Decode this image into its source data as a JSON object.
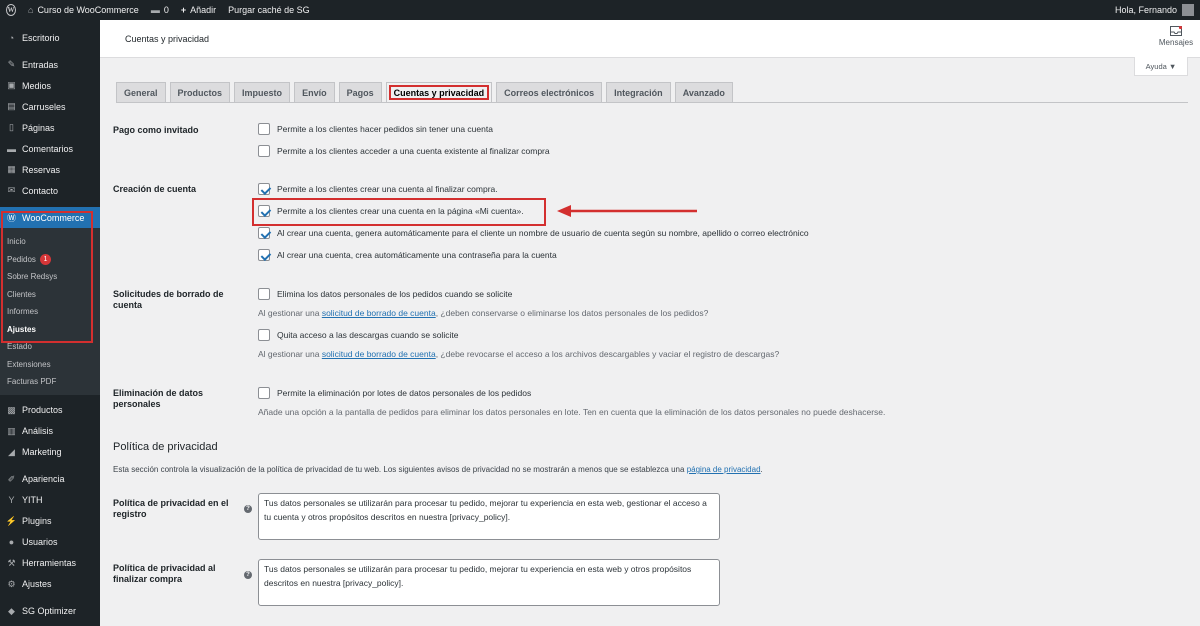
{
  "adminbar": {
    "site_name": "Curso de WooCommerce",
    "comments_count": "0",
    "add_new": "Añadir",
    "purge_cache": "Purgar caché de SG",
    "greeting": "Hola, Fernando"
  },
  "sidebar": {
    "items_top": [
      {
        "label": "Escritorio",
        "icon": "dashboard-icon",
        "glyph": "◔"
      },
      {
        "label": "Entradas",
        "icon": "pin-icon",
        "glyph": "✎"
      },
      {
        "label": "Medios",
        "icon": "media-icon",
        "glyph": "▣"
      },
      {
        "label": "Carruseles",
        "icon": "carousel-icon",
        "glyph": "▤"
      },
      {
        "label": "Páginas",
        "icon": "pages-icon",
        "glyph": "▯"
      },
      {
        "label": "Comentarios",
        "icon": "comments-icon",
        "glyph": "▬"
      },
      {
        "label": "Reservas",
        "icon": "calendar-icon",
        "glyph": "▦"
      },
      {
        "label": "Contacto",
        "icon": "mail-icon",
        "glyph": "✉"
      }
    ],
    "woocommerce": {
      "label": "WooCommerce",
      "icon": "woocommerce-icon",
      "glyph": "Ⓦ"
    },
    "submenu": [
      "Inicio",
      "Pedidos",
      "Sobre Redsys",
      "Clientes",
      "Informes",
      "Ajustes",
      "Estado",
      "Extensiones",
      "Facturas PDF"
    ],
    "orders_badge": "1",
    "items_bottom": [
      {
        "label": "Productos",
        "icon": "products-icon",
        "glyph": "▩"
      },
      {
        "label": "Análisis",
        "icon": "analytics-icon",
        "glyph": "▥"
      },
      {
        "label": "Marketing",
        "icon": "megaphone-icon",
        "glyph": "◢"
      },
      {
        "label": "Apariencia",
        "icon": "brush-icon",
        "glyph": "✐"
      },
      {
        "label": "YITH",
        "icon": "yith-icon",
        "glyph": "Y"
      },
      {
        "label": "Plugins",
        "icon": "plugin-icon",
        "glyph": "⚡"
      },
      {
        "label": "Usuarios",
        "icon": "users-icon",
        "glyph": "●"
      },
      {
        "label": "Herramientas",
        "icon": "tools-icon",
        "glyph": "⚒"
      },
      {
        "label": "Ajustes",
        "icon": "settings-icon",
        "glyph": "⚙"
      },
      {
        "label": "SG Optimizer",
        "icon": "optimizer-icon",
        "glyph": "◆"
      }
    ]
  },
  "header": {
    "title": "Cuentas y privacidad",
    "messages": "Mensajes",
    "help": "Ayuda ▼"
  },
  "tabs": [
    "General",
    "Productos",
    "Impuesto",
    "Envío",
    "Pagos",
    "Cuentas y privacidad",
    "Correos electrónicos",
    "Integración",
    "Avanzado"
  ],
  "guest": {
    "label": "Pago como invitado",
    "opt1": "Permite a los clientes hacer pedidos sin tener una cuenta",
    "opt2": "Permite a los clientes acceder a una cuenta existente al finalizar compra"
  },
  "account": {
    "label": "Creación de cuenta",
    "opt1": "Permite a los clientes crear una cuenta al finalizar compra.",
    "opt2": "Permite a los clientes crear una cuenta en la página «Mi cuenta».",
    "opt3": "Al crear una cuenta, genera automáticamente para el cliente un nombre de usuario de cuenta según su nombre, apellido o correo electrónico",
    "opt4": "Al crear una cuenta, crea automáticamente una contraseña para la cuenta"
  },
  "erasure": {
    "label_line1": "Solicitudes de borrado de",
    "label_line2": "cuenta",
    "opt1": "Elimina los datos personales de los pedidos cuando se solicite",
    "desc1_pre": "Al gestionar una",
    "desc_link": "solicitud de borrado de cuenta",
    "desc1_post": ", ¿deben conservarse o eliminarse los datos personales de los pedidos?",
    "opt2": "Quita acceso a las descargas cuando se solicite",
    "desc2_pre": "Al gestionar una",
    "desc2_post": ", ¿debe revocarse el acceso a los archivos descargables y vaciar el registro de descargas?"
  },
  "deletion": {
    "label_line1": "Eliminación de datos",
    "label_line2": "personales",
    "opt1": "Permite la eliminación por lotes de datos personales de los pedidos",
    "desc": "Añade una opción a la pantalla de pedidos para eliminar los datos personales en lote. Ten en cuenta que la eliminación de los datos personales no puede deshacerse."
  },
  "privacy": {
    "title": "Política de privacidad",
    "desc_pre": "Esta sección controla la visualización de la política de privacidad de tu web. Los siguientes avisos de privacidad no se mostrarán a menos que se establezca una",
    "desc_link": "página de privacidad",
    "desc_post": ".",
    "registro_label1": "Política de privacidad en el",
    "registro_label2": "registro",
    "registro_text": "Tus datos personales se utilizarán para procesar tu pedido, mejorar tu experiencia en esta web, gestionar el acceso a tu cuenta y otros propósitos descritos en nuestra [privacy_policy].",
    "checkout_label1": "Política de privacidad al",
    "checkout_label2": "finalizar compra",
    "checkout_text": "Tus datos personales se utilizarán para procesar tu pedido, mejorar tu experiencia en esta web y otros propósitos descritos en nuestra [privacy_policy]."
  },
  "colors": {
    "accent": "#2271b1",
    "highlight": "#d32f2f",
    "sidebar": "#1d2327"
  }
}
